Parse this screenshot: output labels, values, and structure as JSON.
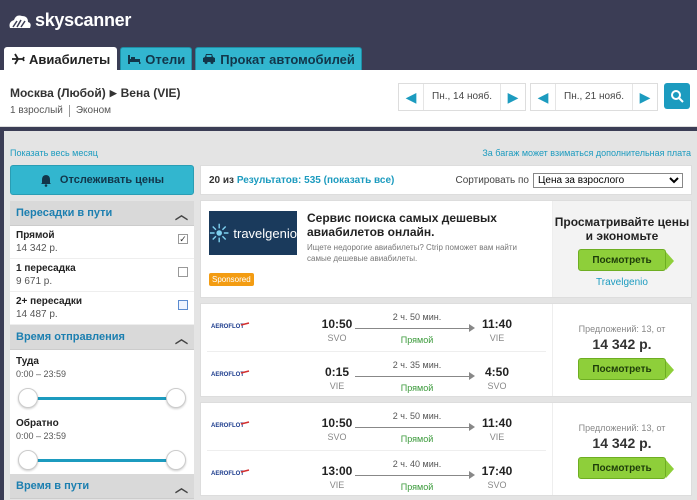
{
  "brand": {
    "name": "skyscanner"
  },
  "tabs": [
    {
      "label": "Авиабилеты",
      "icon": "plane-icon"
    },
    {
      "label": "Отели",
      "icon": "bed-icon"
    },
    {
      "label": "Прокат автомобилей",
      "icon": "car-icon"
    }
  ],
  "search": {
    "from": "Москва (Любой)",
    "to": "Вена (VIE)",
    "passengers": "1 взрослый",
    "cabin": "Эконом",
    "outbound_date": "Пн., 14 нояб.",
    "return_date": "Пн., 21 нояб."
  },
  "links": {
    "whole_month": "Показать весь месяц",
    "baggage": "За багаж может взиматься дополнительная плата"
  },
  "sidebar": {
    "track_label": "Отслеживать цены",
    "stops_header": "Пересадки в пути",
    "stops": [
      {
        "label": "Прямой",
        "price": "14 342 р.",
        "checked": true
      },
      {
        "label": "1 пересадка",
        "price": "9 671 р.",
        "checked": false
      },
      {
        "label": "2+ пересадки",
        "price": "14 487 р.",
        "checked": false
      }
    ],
    "times_header": "Время отправления",
    "outbound_label": "Туда",
    "outbound_range": "0:00 – 23:59",
    "return_label": "Обратно",
    "return_range": "0:00 – 23:59",
    "duration_header": "Время в пути"
  },
  "results": {
    "count_prefix": "20 из",
    "count_link": "Результатов: 535 (показать все)",
    "sort_label": "Сортировать по",
    "sort_value": "Цена за взрослого"
  },
  "ad": {
    "brand": "travelgenio",
    "sponsored": "Sponsored",
    "title": "Сервис поиска самых дешевых авиабилетов онлайн.",
    "description": "Ищете недорогие авиабилеты? Ctrip поможет вам найти самые дешевые авиабилеты.",
    "right_title": "Просматривайте цены и экономьте",
    "button": "Посмотреть",
    "link": "Travelgenio"
  },
  "flights": [
    {
      "legs": [
        {
          "airline": "AEROFLOT",
          "dep_time": "10:50",
          "dep_code": "SVO",
          "duration": "2 ч. 50 мин.",
          "stops": "Прямой",
          "arr_time": "11:40",
          "arr_code": "VIE"
        },
        {
          "airline": "AEROFLOT",
          "dep_time": "0:15",
          "dep_code": "VIE",
          "duration": "2 ч. 35 мин.",
          "stops": "Прямой",
          "arr_time": "4:50",
          "arr_code": "SVO"
        }
      ],
      "offers": "Предложений: 13, от",
      "price": "14 342 р.",
      "button": "Посмотреть"
    },
    {
      "legs": [
        {
          "airline": "AEROFLOT",
          "dep_time": "10:50",
          "dep_code": "SVO",
          "duration": "2 ч. 50 мин.",
          "stops": "Прямой",
          "arr_time": "11:40",
          "arr_code": "VIE"
        },
        {
          "airline": "AEROFLOT",
          "dep_time": "13:00",
          "dep_code": "VIE",
          "duration": "2 ч. 40 мин.",
          "stops": "Прямой",
          "arr_time": "17:40",
          "arr_code": "SVO"
        }
      ],
      "offers": "Предложений: 13, от",
      "price": "14 342 р.",
      "button": "Посмотреть"
    }
  ],
  "colors": {
    "header_bg": "#3b3d55",
    "accent": "#1c9bbf",
    "tab_inactive": "#32b6cf",
    "button_green": "#8ecf3a"
  }
}
